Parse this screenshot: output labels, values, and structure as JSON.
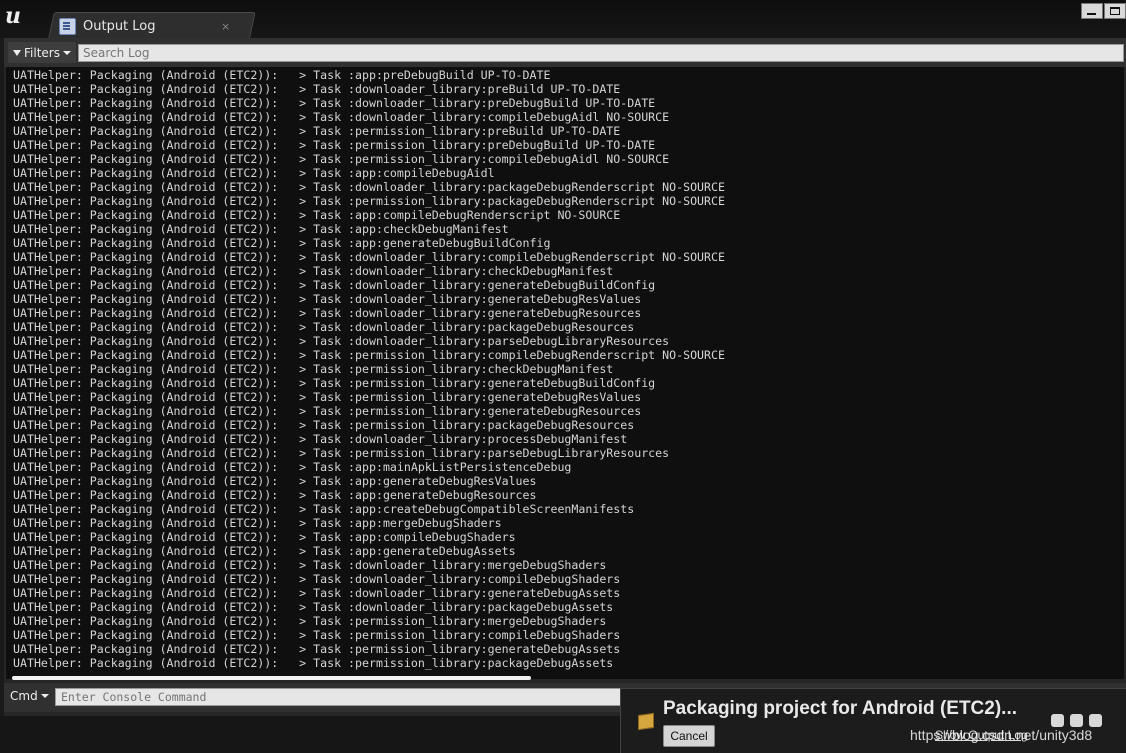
{
  "window": {
    "tab_title": "Output Log",
    "tab_close": "×"
  },
  "toolbar": {
    "filters_label": "Filters",
    "search_placeholder": "Search Log"
  },
  "log_lines": [
    "UATHelper: Packaging (Android (ETC2)):   > Task :app:preDebugBuild UP-TO-DATE",
    "UATHelper: Packaging (Android (ETC2)):   > Task :downloader_library:preBuild UP-TO-DATE",
    "UATHelper: Packaging (Android (ETC2)):   > Task :downloader_library:preDebugBuild UP-TO-DATE",
    "UATHelper: Packaging (Android (ETC2)):   > Task :downloader_library:compileDebugAidl NO-SOURCE",
    "UATHelper: Packaging (Android (ETC2)):   > Task :permission_library:preBuild UP-TO-DATE",
    "UATHelper: Packaging (Android (ETC2)):   > Task :permission_library:preDebugBuild UP-TO-DATE",
    "UATHelper: Packaging (Android (ETC2)):   > Task :permission_library:compileDebugAidl NO-SOURCE",
    "UATHelper: Packaging (Android (ETC2)):   > Task :app:compileDebugAidl",
    "UATHelper: Packaging (Android (ETC2)):   > Task :downloader_library:packageDebugRenderscript NO-SOURCE",
    "UATHelper: Packaging (Android (ETC2)):   > Task :permission_library:packageDebugRenderscript NO-SOURCE",
    "UATHelper: Packaging (Android (ETC2)):   > Task :app:compileDebugRenderscript NO-SOURCE",
    "UATHelper: Packaging (Android (ETC2)):   > Task :app:checkDebugManifest",
    "UATHelper: Packaging (Android (ETC2)):   > Task :app:generateDebugBuildConfig",
    "UATHelper: Packaging (Android (ETC2)):   > Task :downloader_library:compileDebugRenderscript NO-SOURCE",
    "UATHelper: Packaging (Android (ETC2)):   > Task :downloader_library:checkDebugManifest",
    "UATHelper: Packaging (Android (ETC2)):   > Task :downloader_library:generateDebugBuildConfig",
    "UATHelper: Packaging (Android (ETC2)):   > Task :downloader_library:generateDebugResValues",
    "UATHelper: Packaging (Android (ETC2)):   > Task :downloader_library:generateDebugResources",
    "UATHelper: Packaging (Android (ETC2)):   > Task :downloader_library:packageDebugResources",
    "UATHelper: Packaging (Android (ETC2)):   > Task :downloader_library:parseDebugLibraryResources",
    "UATHelper: Packaging (Android (ETC2)):   > Task :permission_library:compileDebugRenderscript NO-SOURCE",
    "UATHelper: Packaging (Android (ETC2)):   > Task :permission_library:checkDebugManifest",
    "UATHelper: Packaging (Android (ETC2)):   > Task :permission_library:generateDebugBuildConfig",
    "UATHelper: Packaging (Android (ETC2)):   > Task :permission_library:generateDebugResValues",
    "UATHelper: Packaging (Android (ETC2)):   > Task :permission_library:generateDebugResources",
    "UATHelper: Packaging (Android (ETC2)):   > Task :permission_library:packageDebugResources",
    "UATHelper: Packaging (Android (ETC2)):   > Task :downloader_library:processDebugManifest",
    "UATHelper: Packaging (Android (ETC2)):   > Task :permission_library:parseDebugLibraryResources",
    "UATHelper: Packaging (Android (ETC2)):   > Task :app:mainApkListPersistenceDebug",
    "UATHelper: Packaging (Android (ETC2)):   > Task :app:generateDebugResValues",
    "UATHelper: Packaging (Android (ETC2)):   > Task :app:generateDebugResources",
    "UATHelper: Packaging (Android (ETC2)):   > Task :app:createDebugCompatibleScreenManifests",
    "UATHelper: Packaging (Android (ETC2)):   > Task :app:mergeDebugShaders",
    "UATHelper: Packaging (Android (ETC2)):   > Task :app:compileDebugShaders",
    "UATHelper: Packaging (Android (ETC2)):   > Task :app:generateDebugAssets",
    "UATHelper: Packaging (Android (ETC2)):   > Task :downloader_library:mergeDebugShaders",
    "UATHelper: Packaging (Android (ETC2)):   > Task :downloader_library:compileDebugShaders",
    "UATHelper: Packaging (Android (ETC2)):   > Task :downloader_library:generateDebugAssets",
    "UATHelper: Packaging (Android (ETC2)):   > Task :downloader_library:packageDebugAssets",
    "UATHelper: Packaging (Android (ETC2)):   > Task :permission_library:mergeDebugShaders",
    "UATHelper: Packaging (Android (ETC2)):   > Task :permission_library:compileDebugShaders",
    "UATHelper: Packaging (Android (ETC2)):   > Task :permission_library:generateDebugAssets",
    "UATHelper: Packaging (Android (ETC2)):   > Task :permission_library:packageDebugAssets"
  ],
  "console": {
    "cmd_label": "Cmd",
    "placeholder": "Enter Console Command"
  },
  "notification": {
    "title": "Packaging project for Android (ETC2)...",
    "cancel_label": "Cancel",
    "show_output_label": "Show Output Log"
  },
  "watermark": "https://blog.csdn.net/unity3d8",
  "colors": {
    "log_background": "#0f0f0f",
    "log_text": "#d4d4d4",
    "panel": "#262626",
    "accent_icon": "#d5a53e"
  },
  "icons": [
    "unreal-logo-icon",
    "output-log-icon",
    "close-icon",
    "minimize-icon",
    "maximize-icon",
    "filter-icon",
    "chevron-down-icon",
    "package-icon",
    "throbber-icon"
  ]
}
